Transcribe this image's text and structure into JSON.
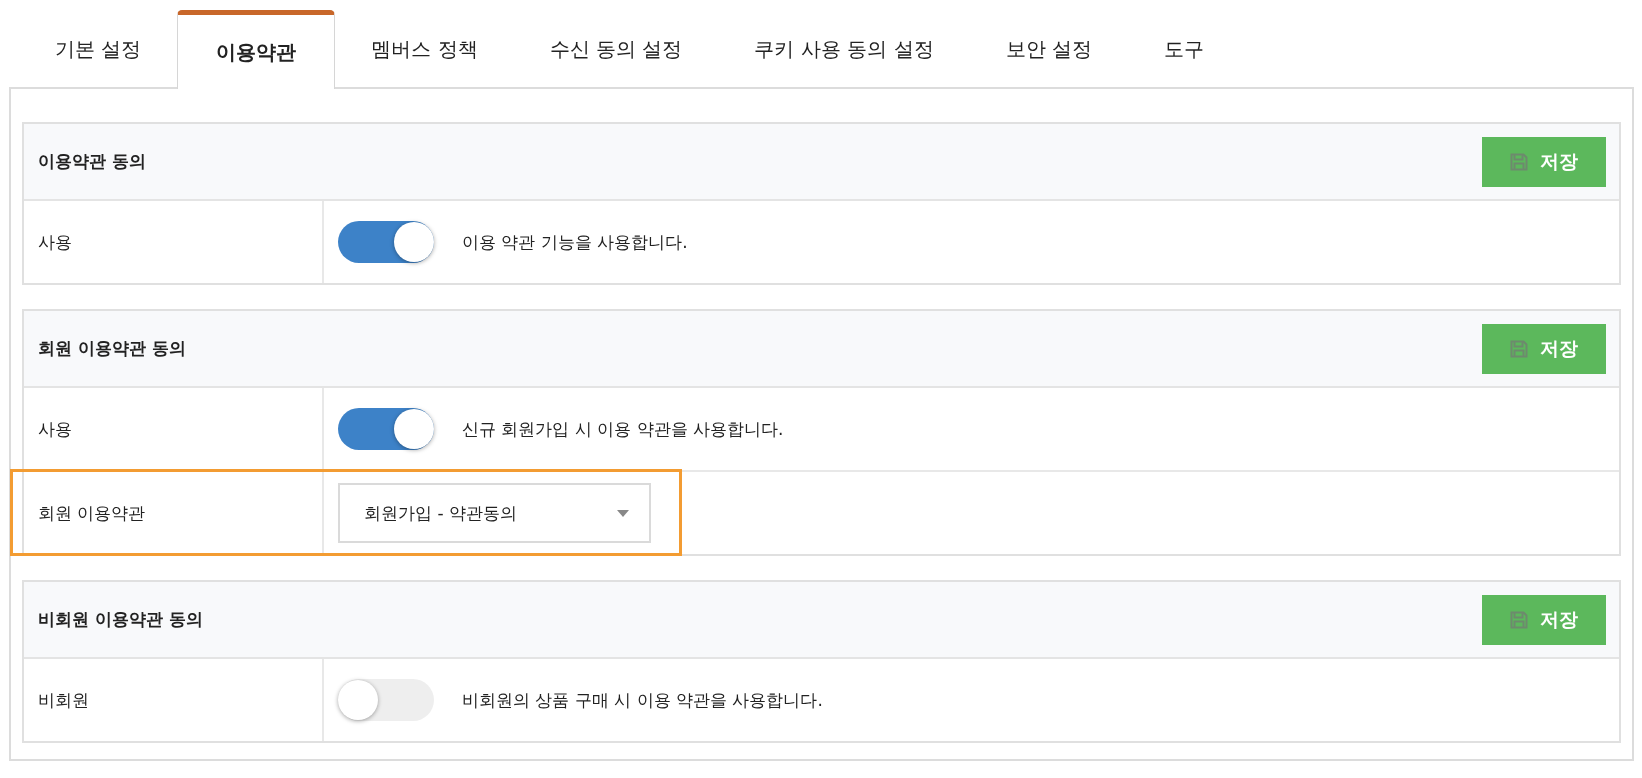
{
  "tabs": [
    {
      "label": "기본 설정",
      "selected": false
    },
    {
      "label": "이용약관",
      "selected": true
    },
    {
      "label": "멤버스 정책",
      "selected": false
    },
    {
      "label": "수신 동의 설정",
      "selected": false
    },
    {
      "label": "쿠키 사용 동의 설정",
      "selected": false
    },
    {
      "label": "보안 설정",
      "selected": false
    },
    {
      "label": "도구",
      "selected": false
    }
  ],
  "sections": [
    {
      "title": "이용약관 동의",
      "save_button": "저장",
      "rows": [
        {
          "kind": "toggle",
          "label": "사용",
          "on": true,
          "description": "이용 약관 기능을 사용합니다.",
          "highlighted": false
        }
      ]
    },
    {
      "title": "회원 이용약관 동의",
      "save_button": "저장",
      "rows": [
        {
          "kind": "toggle",
          "label": "사용",
          "on": true,
          "description": "신규 회원가입 시 이용 약관을 사용합니다.",
          "highlighted": false
        },
        {
          "kind": "select",
          "label": "회원 이용약관",
          "value": "회원가입 - 약관동의",
          "highlighted": true
        }
      ]
    },
    {
      "title": "비회원 이용약관 동의",
      "save_button": "저장",
      "rows": [
        {
          "kind": "toggle",
          "label": "비회원",
          "on": false,
          "description": "비회원의 상품 구매 시 이용 약관을 사용합니다.",
          "highlighted": false
        }
      ]
    }
  ]
}
